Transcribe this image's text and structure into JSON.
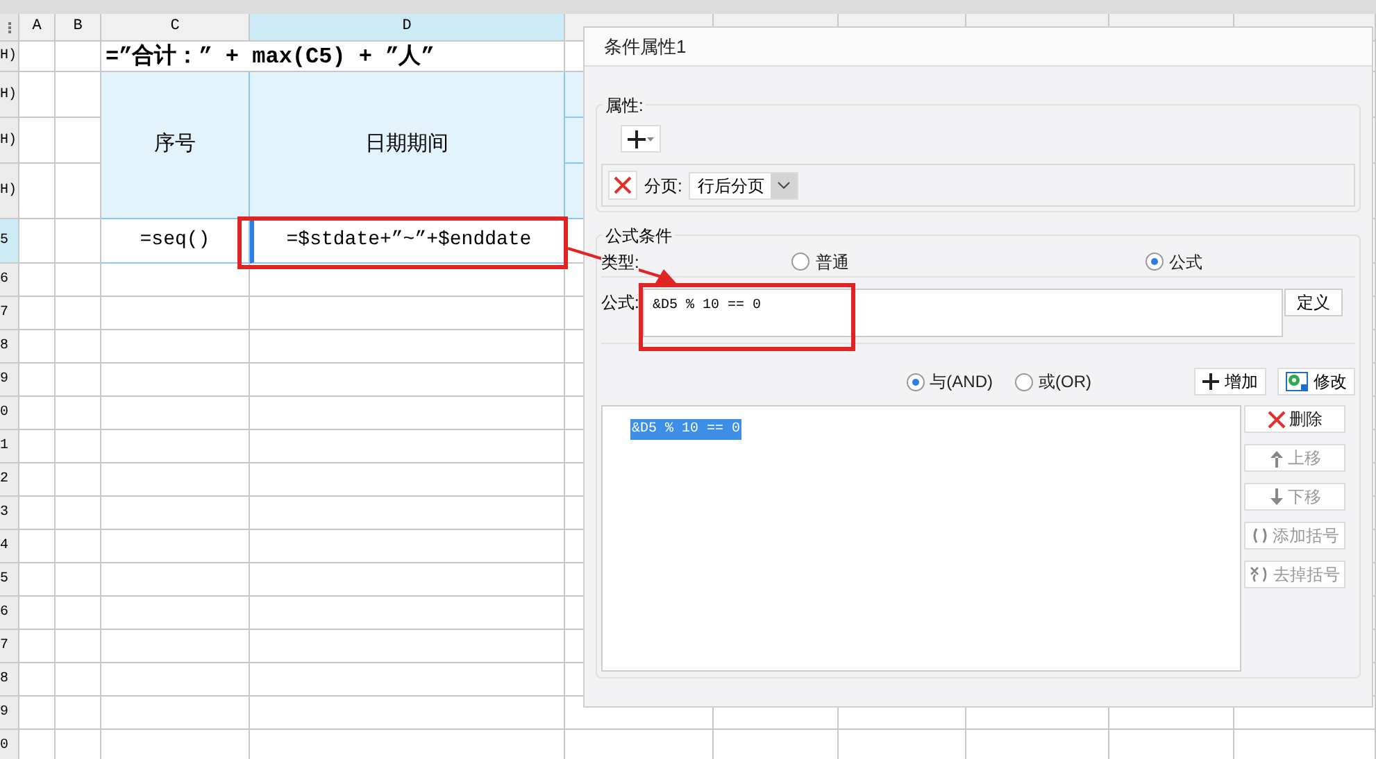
{
  "sheet": {
    "column_headers": [
      {
        "label": "A",
        "selected": false
      },
      {
        "label": "B",
        "selected": false
      },
      {
        "label": "C",
        "selected": false
      },
      {
        "label": "D",
        "selected": true
      }
    ],
    "row_headers": [
      {
        "label": "H)",
        "selected": false
      },
      {
        "label": "H)",
        "selected": false
      },
      {
        "label": "H)",
        "selected": false
      },
      {
        "label": "H)",
        "selected": false
      },
      {
        "label": "5",
        "selected": true
      },
      {
        "label": "6",
        "selected": false
      },
      {
        "label": "7",
        "selected": false
      },
      {
        "label": "8",
        "selected": false
      },
      {
        "label": "9",
        "selected": false
      },
      {
        "label": "0",
        "selected": false
      },
      {
        "label": "1",
        "selected": false
      },
      {
        "label": "2",
        "selected": false
      },
      {
        "label": "3",
        "selected": false
      },
      {
        "label": "4",
        "selected": false
      },
      {
        "label": "5",
        "selected": false
      },
      {
        "label": "6",
        "selected": false
      },
      {
        "label": "7",
        "selected": false
      },
      {
        "label": "8",
        "selected": false
      },
      {
        "label": "9",
        "selected": false
      },
      {
        "label": "0",
        "selected": false
      }
    ],
    "title_formula": "=”合计：” + max(C5) + ”人”",
    "header_cells": [
      "序号",
      "日期期间"
    ],
    "data_cells": [
      "=seq()",
      "=$stdate+”~”+$enddate"
    ]
  },
  "dialog": {
    "title": "条件属性1",
    "properties": {
      "legend": "属性:",
      "page_break": {
        "label": "分页:",
        "value": "行后分页"
      }
    },
    "formula_condition": {
      "legend": "公式条件",
      "type_label": "类型:",
      "types": [
        {
          "label": "普通",
          "selected": false
        },
        {
          "label": "公式",
          "selected": true
        }
      ],
      "formula_label": "公式:",
      "formula_value": "&D5 % 10 == 0",
      "define_button": "定义",
      "logic": [
        {
          "label": "与(AND)",
          "selected": true
        },
        {
          "label": "或(OR)",
          "selected": false
        }
      ],
      "action_buttons": [
        {
          "label": "增加",
          "kind": "add"
        },
        {
          "label": "修改",
          "kind": "edit"
        }
      ],
      "conditions": [
        {
          "text": "&D5 % 10 == 0",
          "selected": true
        }
      ],
      "side_buttons": [
        {
          "label": "删除",
          "kind": "delete",
          "disabled": false
        },
        {
          "label": "上移",
          "kind": "up",
          "disabled": true
        },
        {
          "label": "下移",
          "kind": "down",
          "disabled": true
        },
        {
          "label": "添加括号",
          "kind": "add-paren",
          "disabled": true
        },
        {
          "label": "去掉括号",
          "kind": "remove-paren",
          "disabled": true
        }
      ]
    }
  }
}
